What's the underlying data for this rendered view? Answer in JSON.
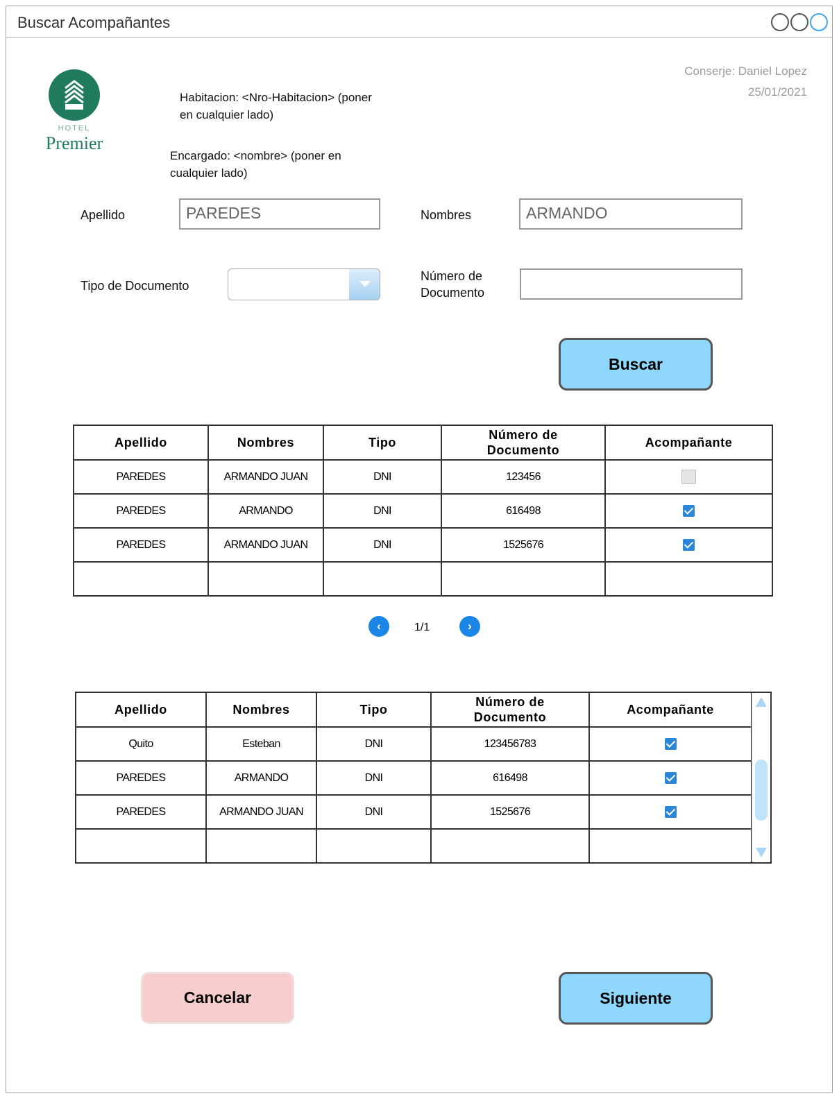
{
  "window": {
    "title": "Buscar Acompañantes"
  },
  "header": {
    "conserje": "Conserje: Daniel Lopez",
    "fecha": "25/01/2021",
    "logo_hotel": "HOTEL",
    "logo_name": "Premier",
    "habitacion_note_1": "Habitacion: <Nro-Habitacion> (poner",
    "habitacion_note_2": "en cualquier lado)",
    "encargado_note_1": "Encargado: <nombre> (poner en",
    "encargado_note_2": "cualquier lado)"
  },
  "form": {
    "apellido_label": "Apellido",
    "apellido_value": "PAREDES",
    "nombres_label": "Nombres",
    "nombres_value": "ARMANDO",
    "tipo_doc_label": "Tipo de Documento",
    "tipo_doc_value": "",
    "num_doc_label_1": "Número de",
    "num_doc_label_2": "Documento",
    "num_doc_value": "",
    "buscar_label": "Buscar"
  },
  "results_table": {
    "headers": [
      "Apellido",
      "Nombres",
      "Tipo",
      "Número de",
      "Documento",
      "Acompañante"
    ],
    "rows": [
      {
        "apellido": "PAREDES",
        "nombres": "ARMANDO JUAN",
        "tipo": "DNI",
        "numero": "123456",
        "acompanante": false
      },
      {
        "apellido": "PAREDES",
        "nombres": "ARMANDO",
        "tipo": "DNI",
        "numero": "616498",
        "acompanante": true
      },
      {
        "apellido": "PAREDES",
        "nombres": "ARMANDO JUAN",
        "tipo": "DNI",
        "numero": "1525676",
        "acompanante": true
      }
    ]
  },
  "pager": {
    "prev_icon": "chevron-left-icon",
    "text": "1/1",
    "next_icon": "chevron-right-icon"
  },
  "selected_table": {
    "headers": [
      "Apellido",
      "Nombres",
      "Tipo",
      "Número de",
      "Documento",
      "Acompañante"
    ],
    "rows": [
      {
        "apellido": "Quito",
        "nombres": "Esteban",
        "tipo": "DNI",
        "numero": "123456783",
        "acompanante": true
      },
      {
        "apellido": "PAREDES",
        "nombres": "ARMANDO",
        "tipo": "DNI",
        "numero": "616498",
        "acompanante": true
      },
      {
        "apellido": "PAREDES",
        "nombres": "ARMANDO JUAN",
        "tipo": "DNI",
        "numero": "1525676",
        "acompanante": true
      }
    ]
  },
  "footer": {
    "cancelar_label": "Cancelar",
    "siguiente_label": "Siguiente"
  },
  "colors": {
    "accent_blue": "#8fd7fb",
    "cancel_pink": "#f7cccc",
    "brand_green": "#1f7a5e",
    "checkbox_blue": "#2a86d6"
  }
}
